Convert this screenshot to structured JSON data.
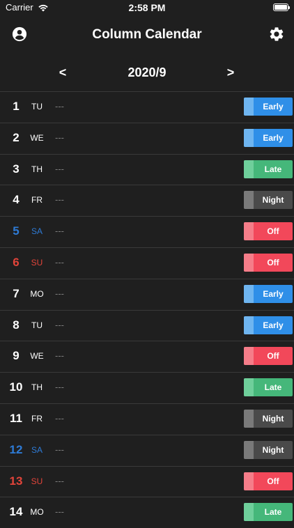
{
  "status_bar": {
    "carrier": "Carrier",
    "time": "2:58 PM"
  },
  "nav": {
    "title": "Column Calendar",
    "left_icon": "account-circle-icon",
    "right_icon": "gear-icon"
  },
  "month": {
    "prev": "<",
    "label": "2020/9",
    "next": ">"
  },
  "shift_types": {
    "Early": {
      "main": "#2f8fe8",
      "stripe": "#6fb5f0"
    },
    "Late": {
      "main": "#45b77a",
      "stripe": "#6fcf9b"
    },
    "Night": {
      "main": "#4a4a4a",
      "stripe": "#7a7a7a"
    },
    "Off": {
      "main": "#f2485a",
      "stripe": "#f57d89"
    }
  },
  "days": [
    {
      "num": "1",
      "weekday": "TU",
      "note": "---",
      "shift": "Early",
      "kind": "weekday"
    },
    {
      "num": "2",
      "weekday": "WE",
      "note": "---",
      "shift": "Early",
      "kind": "weekday"
    },
    {
      "num": "3",
      "weekday": "TH",
      "note": "---",
      "shift": "Late",
      "kind": "weekday"
    },
    {
      "num": "4",
      "weekday": "FR",
      "note": "---",
      "shift": "Night",
      "kind": "weekday"
    },
    {
      "num": "5",
      "weekday": "SA",
      "note": "---",
      "shift": "Off",
      "kind": "sat"
    },
    {
      "num": "6",
      "weekday": "SU",
      "note": "---",
      "shift": "Off",
      "kind": "sun"
    },
    {
      "num": "7",
      "weekday": "MO",
      "note": "---",
      "shift": "Early",
      "kind": "weekday"
    },
    {
      "num": "8",
      "weekday": "TU",
      "note": "---",
      "shift": "Early",
      "kind": "weekday"
    },
    {
      "num": "9",
      "weekday": "WE",
      "note": "---",
      "shift": "Off",
      "kind": "weekday"
    },
    {
      "num": "10",
      "weekday": "TH",
      "note": "---",
      "shift": "Late",
      "kind": "weekday"
    },
    {
      "num": "11",
      "weekday": "FR",
      "note": "---",
      "shift": "Night",
      "kind": "weekday"
    },
    {
      "num": "12",
      "weekday": "SA",
      "note": "---",
      "shift": "Night",
      "kind": "sat"
    },
    {
      "num": "13",
      "weekday": "SU",
      "note": "---",
      "shift": "Off",
      "kind": "sun"
    },
    {
      "num": "14",
      "weekday": "MO",
      "note": "---",
      "shift": "Late",
      "kind": "weekday"
    }
  ]
}
